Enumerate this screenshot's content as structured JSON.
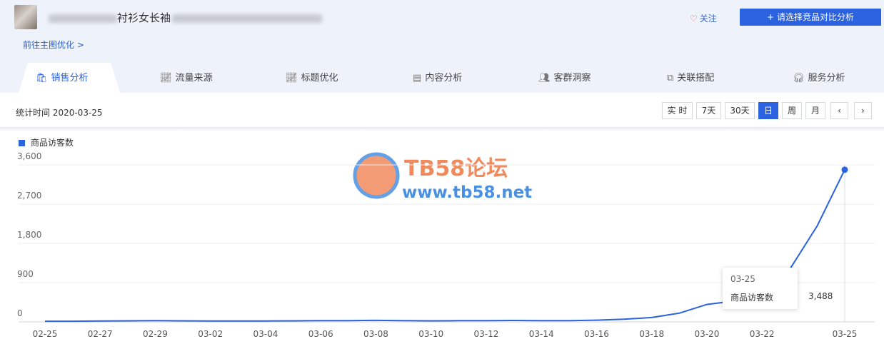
{
  "header": {
    "title": "衬衫女长袖",
    "follow_label": "关注",
    "compare_label": "请选择竞品对比分析",
    "main_link": "前往主图优化 >"
  },
  "tabs": [
    {
      "label": "销售分析",
      "icon": "bag-icon",
      "active": true
    },
    {
      "label": "流量来源",
      "icon": "trend-icon"
    },
    {
      "label": "标题优化",
      "icon": "trend-icon"
    },
    {
      "label": "内容分析",
      "icon": "document-icon"
    },
    {
      "label": "客群洞察",
      "icon": "users-icon"
    },
    {
      "label": "关联搭配",
      "icon": "link-icon"
    },
    {
      "label": "服务分析",
      "icon": "headset-icon"
    }
  ],
  "toolbar": {
    "stat_label": "统计时间 2020-03-25",
    "buttons": [
      "实 时",
      "7天",
      "30天",
      "日",
      "周",
      "月"
    ],
    "active_button": "日"
  },
  "watermark": {
    "line1": "TB58论坛",
    "line2": "www.tb58.net"
  },
  "colors": {
    "accent": "#2a62e0",
    "watermark_orange": "#f08a5d",
    "watermark_blue": "#4a90e2"
  },
  "chart_data": {
    "type": "line",
    "legend": [
      "商品访客数"
    ],
    "ylim": [
      0,
      3600
    ],
    "y_ticks": [
      "0",
      "900",
      "1,800",
      "2,700",
      "3,600"
    ],
    "x_ticks": [
      "02-25",
      "02-27",
      "02-29",
      "03-02",
      "03-04",
      "03-06",
      "03-08",
      "03-10",
      "03-12",
      "03-14",
      "03-16",
      "03-18",
      "03-20",
      "03-22",
      "03-25"
    ],
    "series": [
      {
        "name": "商品访客数",
        "x": [
          "02-25",
          "02-26",
          "02-27",
          "02-28",
          "02-29",
          "03-01",
          "03-02",
          "03-03",
          "03-04",
          "03-05",
          "03-06",
          "03-07",
          "03-08",
          "03-09",
          "03-10",
          "03-11",
          "03-12",
          "03-13",
          "03-14",
          "03-15",
          "03-16",
          "03-17",
          "03-18",
          "03-19",
          "03-20",
          "03-21",
          "03-22",
          "03-23",
          "03-24",
          "03-25"
        ],
        "values": [
          15,
          15,
          20,
          25,
          30,
          25,
          20,
          20,
          22,
          25,
          28,
          30,
          35,
          30,
          25,
          28,
          30,
          32,
          30,
          30,
          40,
          60,
          100,
          200,
          400,
          480,
          620,
          1200,
          2200,
          3488
        ]
      }
    ],
    "tooltip": {
      "date": "03-25",
      "label": "商品访客数",
      "value": "3,488"
    }
  }
}
